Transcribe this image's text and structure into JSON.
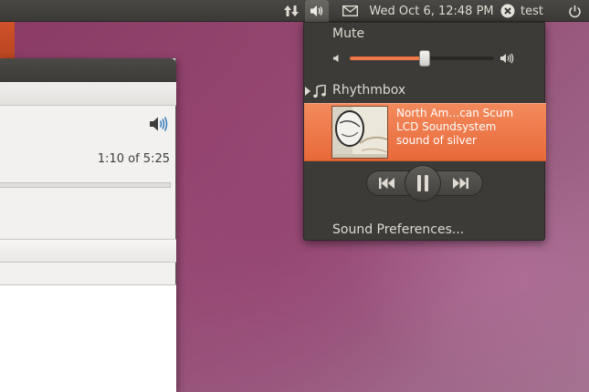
{
  "top_panel": {
    "clock": "Wed Oct  6, 12:48 PM",
    "user": "test",
    "icons": [
      "network-icon",
      "volume-icon",
      "mail-icon",
      "user-status-icon",
      "power-icon"
    ]
  },
  "app_window": {
    "time_display": "1:10 of 5:25",
    "icons": [
      "volume-high-icon"
    ]
  },
  "sound_menu": {
    "mute_label": "Mute",
    "volume_level": 0.52,
    "player_name": "Rhythmbox",
    "track": {
      "title": "North Am…can Scum",
      "artist": "LCD Soundsystem",
      "album": "sound of silver"
    },
    "transport_icons": [
      "previous-icon",
      "pause-icon",
      "next-icon"
    ],
    "preferences_label": "Sound Preferences..."
  },
  "colors": {
    "panel": "#3c3b37",
    "accent": "#f07746",
    "menu_text": "#dfdbd2",
    "desktop": "#93466f"
  }
}
